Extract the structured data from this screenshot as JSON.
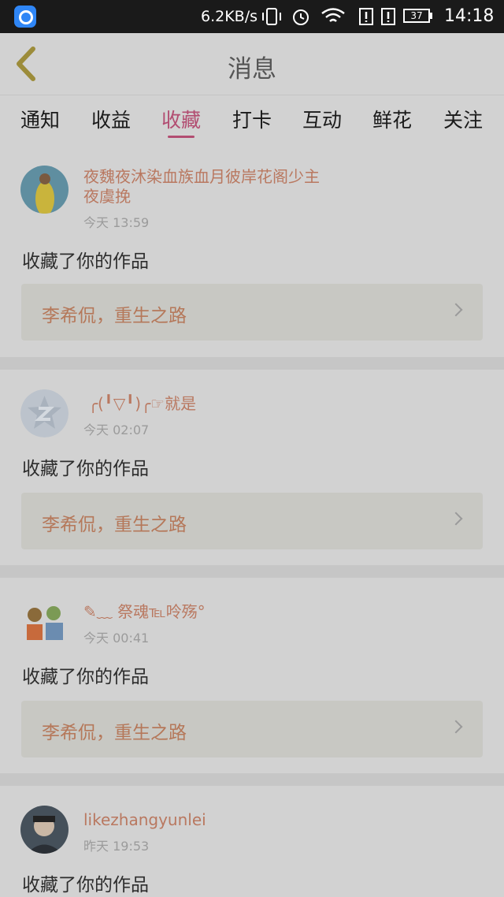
{
  "status_bar": {
    "speed": "6.2KB/s",
    "battery": "37",
    "time": "14:18"
  },
  "header": {
    "title": "消息"
  },
  "tabs": [
    {
      "label": "通知"
    },
    {
      "label": "收益"
    },
    {
      "label": "收藏",
      "active": true
    },
    {
      "label": "打卡"
    },
    {
      "label": "互动"
    },
    {
      "label": "鲜花"
    },
    {
      "label": "关注"
    }
  ],
  "messages": [
    {
      "user": "夜魏夜沐染血族血月彼岸花阁少主夜虞挽",
      "time": "今天 13:59",
      "action": "收藏了你的作品",
      "work_title": "李希侃，重生之路"
    },
    {
      "user": "╭(╹▽╹)╭☞就是",
      "time": "今天 02:07",
      "action": "收藏了你的作品",
      "work_title": "李希侃，重生之路"
    },
    {
      "user": "✎﹏ 祭魂℡呤殇°",
      "time": "今天 00:41",
      "action": "收藏了你的作品",
      "work_title": "李希侃，重生之路"
    },
    {
      "user": "likezhangyunlei",
      "time": "昨天 19:53",
      "action": "收藏了你的作品",
      "work_title": ""
    }
  ],
  "colors": {
    "accent": "#b24d71",
    "username": "#b97860"
  }
}
